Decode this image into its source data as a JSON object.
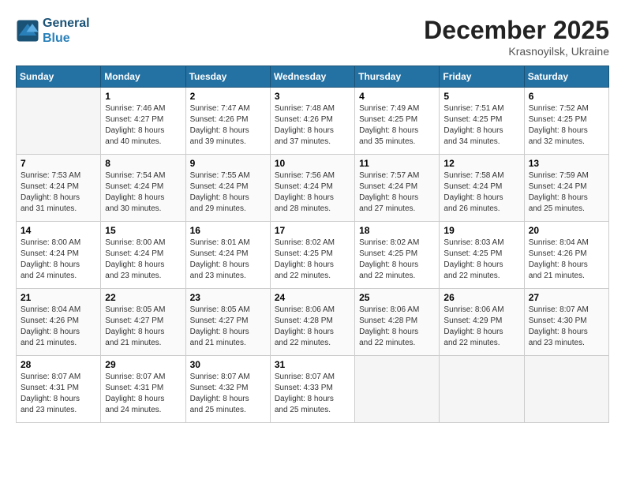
{
  "header": {
    "logo_line1": "General",
    "logo_line2": "Blue",
    "month_title": "December 2025",
    "location": "Krasnoyilsk, Ukraine"
  },
  "weekdays": [
    "Sunday",
    "Monday",
    "Tuesday",
    "Wednesday",
    "Thursday",
    "Friday",
    "Saturday"
  ],
  "weeks": [
    [
      {
        "day": "",
        "info": ""
      },
      {
        "day": "1",
        "info": "Sunrise: 7:46 AM\nSunset: 4:27 PM\nDaylight: 8 hours\nand 40 minutes."
      },
      {
        "day": "2",
        "info": "Sunrise: 7:47 AM\nSunset: 4:26 PM\nDaylight: 8 hours\nand 39 minutes."
      },
      {
        "day": "3",
        "info": "Sunrise: 7:48 AM\nSunset: 4:26 PM\nDaylight: 8 hours\nand 37 minutes."
      },
      {
        "day": "4",
        "info": "Sunrise: 7:49 AM\nSunset: 4:25 PM\nDaylight: 8 hours\nand 35 minutes."
      },
      {
        "day": "5",
        "info": "Sunrise: 7:51 AM\nSunset: 4:25 PM\nDaylight: 8 hours\nand 34 minutes."
      },
      {
        "day": "6",
        "info": "Sunrise: 7:52 AM\nSunset: 4:25 PM\nDaylight: 8 hours\nand 32 minutes."
      }
    ],
    [
      {
        "day": "7",
        "info": "Sunrise: 7:53 AM\nSunset: 4:24 PM\nDaylight: 8 hours\nand 31 minutes."
      },
      {
        "day": "8",
        "info": "Sunrise: 7:54 AM\nSunset: 4:24 PM\nDaylight: 8 hours\nand 30 minutes."
      },
      {
        "day": "9",
        "info": "Sunrise: 7:55 AM\nSunset: 4:24 PM\nDaylight: 8 hours\nand 29 minutes."
      },
      {
        "day": "10",
        "info": "Sunrise: 7:56 AM\nSunset: 4:24 PM\nDaylight: 8 hours\nand 28 minutes."
      },
      {
        "day": "11",
        "info": "Sunrise: 7:57 AM\nSunset: 4:24 PM\nDaylight: 8 hours\nand 27 minutes."
      },
      {
        "day": "12",
        "info": "Sunrise: 7:58 AM\nSunset: 4:24 PM\nDaylight: 8 hours\nand 26 minutes."
      },
      {
        "day": "13",
        "info": "Sunrise: 7:59 AM\nSunset: 4:24 PM\nDaylight: 8 hours\nand 25 minutes."
      }
    ],
    [
      {
        "day": "14",
        "info": "Sunrise: 8:00 AM\nSunset: 4:24 PM\nDaylight: 8 hours\nand 24 minutes."
      },
      {
        "day": "15",
        "info": "Sunrise: 8:00 AM\nSunset: 4:24 PM\nDaylight: 8 hours\nand 23 minutes."
      },
      {
        "day": "16",
        "info": "Sunrise: 8:01 AM\nSunset: 4:24 PM\nDaylight: 8 hours\nand 23 minutes."
      },
      {
        "day": "17",
        "info": "Sunrise: 8:02 AM\nSunset: 4:25 PM\nDaylight: 8 hours\nand 22 minutes."
      },
      {
        "day": "18",
        "info": "Sunrise: 8:02 AM\nSunset: 4:25 PM\nDaylight: 8 hours\nand 22 minutes."
      },
      {
        "day": "19",
        "info": "Sunrise: 8:03 AM\nSunset: 4:25 PM\nDaylight: 8 hours\nand 22 minutes."
      },
      {
        "day": "20",
        "info": "Sunrise: 8:04 AM\nSunset: 4:26 PM\nDaylight: 8 hours\nand 21 minutes."
      }
    ],
    [
      {
        "day": "21",
        "info": "Sunrise: 8:04 AM\nSunset: 4:26 PM\nDaylight: 8 hours\nand 21 minutes."
      },
      {
        "day": "22",
        "info": "Sunrise: 8:05 AM\nSunset: 4:27 PM\nDaylight: 8 hours\nand 21 minutes."
      },
      {
        "day": "23",
        "info": "Sunrise: 8:05 AM\nSunset: 4:27 PM\nDaylight: 8 hours\nand 21 minutes."
      },
      {
        "day": "24",
        "info": "Sunrise: 8:06 AM\nSunset: 4:28 PM\nDaylight: 8 hours\nand 22 minutes."
      },
      {
        "day": "25",
        "info": "Sunrise: 8:06 AM\nSunset: 4:28 PM\nDaylight: 8 hours\nand 22 minutes."
      },
      {
        "day": "26",
        "info": "Sunrise: 8:06 AM\nSunset: 4:29 PM\nDaylight: 8 hours\nand 22 minutes."
      },
      {
        "day": "27",
        "info": "Sunrise: 8:07 AM\nSunset: 4:30 PM\nDaylight: 8 hours\nand 23 minutes."
      }
    ],
    [
      {
        "day": "28",
        "info": "Sunrise: 8:07 AM\nSunset: 4:31 PM\nDaylight: 8 hours\nand 23 minutes."
      },
      {
        "day": "29",
        "info": "Sunrise: 8:07 AM\nSunset: 4:31 PM\nDaylight: 8 hours\nand 24 minutes."
      },
      {
        "day": "30",
        "info": "Sunrise: 8:07 AM\nSunset: 4:32 PM\nDaylight: 8 hours\nand 25 minutes."
      },
      {
        "day": "31",
        "info": "Sunrise: 8:07 AM\nSunset: 4:33 PM\nDaylight: 8 hours\nand 25 minutes."
      },
      {
        "day": "",
        "info": ""
      },
      {
        "day": "",
        "info": ""
      },
      {
        "day": "",
        "info": ""
      }
    ]
  ]
}
